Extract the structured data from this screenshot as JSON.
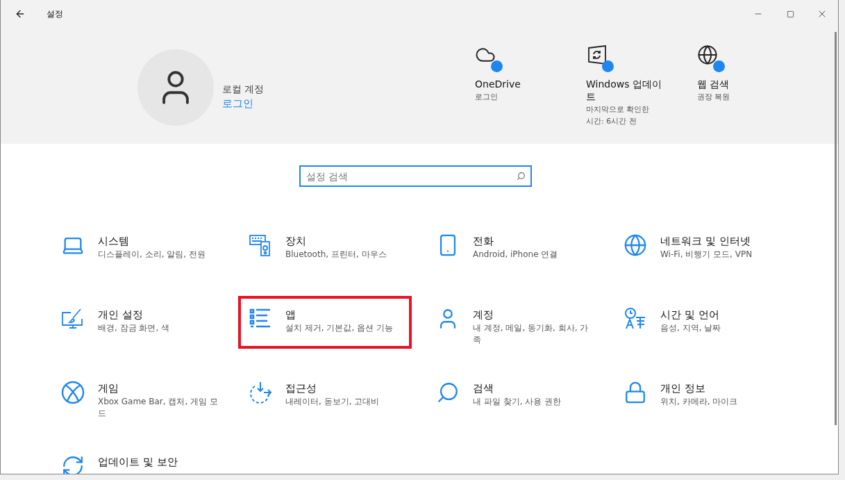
{
  "window": {
    "title": "설정"
  },
  "account": {
    "name": "로컬 계정",
    "link": "로그인"
  },
  "header_items": [
    {
      "title": "OneDrive",
      "subtitle": "로그인"
    },
    {
      "title": "Windows 업데이트",
      "subtitle": "마지막으로 확인한 시간: 6시간 전"
    },
    {
      "title": "웹 검색",
      "subtitle": "권장 복원"
    }
  ],
  "search": {
    "placeholder": "설정 검색"
  },
  "categories": [
    {
      "title": "시스템",
      "subtitle": "디스플레이, 소리, 알림, 전원",
      "highlighted": false
    },
    {
      "title": "장치",
      "subtitle": "Bluetooth, 프린터, 마우스",
      "highlighted": false
    },
    {
      "title": "전화",
      "subtitle": "Android, iPhone 연결",
      "highlighted": false
    },
    {
      "title": "네트워크 및 인터넷",
      "subtitle": "Wi-Fi, 비행기 모드, VPN",
      "highlighted": false
    },
    {
      "title": "개인 설정",
      "subtitle": "배경, 잠금 화면, 색",
      "highlighted": false
    },
    {
      "title": "앱",
      "subtitle": "설치 제거, 기본값, 옵션 기능",
      "highlighted": true
    },
    {
      "title": "계정",
      "subtitle": "내 계정, 메일, 동기화, 회사, 가족",
      "highlighted": false
    },
    {
      "title": "시간 및 언어",
      "subtitle": "음성, 지역, 날짜",
      "highlighted": false
    },
    {
      "title": "게임",
      "subtitle": "Xbox Game Bar, 캡처, 게임 모드",
      "highlighted": false
    },
    {
      "title": "접근성",
      "subtitle": "내레이터, 돋보기, 고대비",
      "highlighted": false
    },
    {
      "title": "검색",
      "subtitle": "내 파일 찾기, 사용 권한",
      "highlighted": false
    },
    {
      "title": "개인 정보",
      "subtitle": "위치, 카메라, 마이크",
      "highlighted": false
    },
    {
      "title": "업데이트 및 보안",
      "highlighted": false
    }
  ]
}
